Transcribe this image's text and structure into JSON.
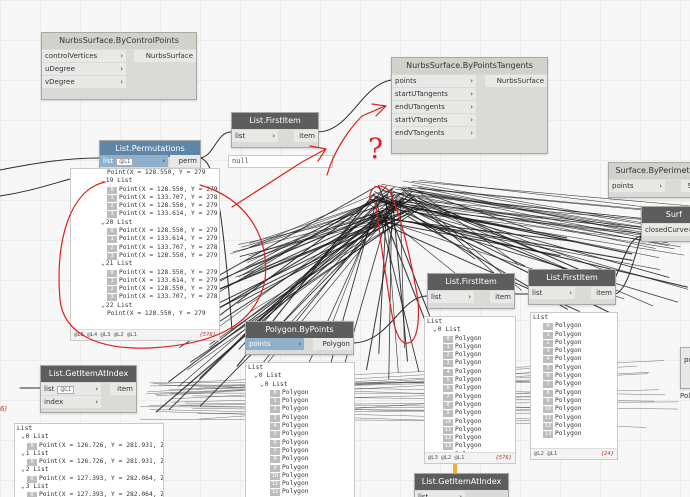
{
  "nodes": {
    "cp": {
      "title": "NurbsSurface.ByControlPoints",
      "inputs": [
        "controlVertices",
        "uDegree",
        "vDegree"
      ],
      "output": "NurbsSurface"
    },
    "pt": {
      "title": "NurbsSurface.ByPointsTangents",
      "inputs": [
        "points",
        "startUTangents",
        "endUTangents",
        "startVTangents",
        "endVTangents"
      ],
      "output": "NurbsSurface"
    },
    "fi1": {
      "title": "List.FirstItem",
      "input": "list",
      "output": "item",
      "preview": "null"
    },
    "perm": {
      "title": "List.Permutations",
      "inputs": [
        "list",
        "length"
      ],
      "output": "perm",
      "preview_rows": [
        {
          "t": "Point(X = 128.550, Y = 279"
        },
        {
          "t": "19 List",
          "h": true
        },
        {
          "i": "0",
          "t": "Point(X = 128.550, Y = 279"
        },
        {
          "i": "1",
          "t": "Point(X = 133.707, Y = 278"
        },
        {
          "i": "2",
          "t": "Point(X = 128.550, Y = 279"
        },
        {
          "i": "3",
          "t": "Point(X = 133.614, Y = 279"
        },
        {
          "t": "20 List",
          "h": true
        },
        {
          "i": "0",
          "t": "Point(X = 128.550, Y = 279"
        },
        {
          "i": "1",
          "t": "Point(X = 133.614, Y = 279"
        },
        {
          "i": "2",
          "t": "Point(X = 133.707, Y = 278"
        },
        {
          "i": "3",
          "t": "Point(X = 128.550, Y = 279"
        },
        {
          "t": "21 List",
          "h": true
        },
        {
          "i": "0",
          "t": "Point(X = 128.550, Y = 279"
        },
        {
          "i": "1",
          "t": "Point(X = 133.614, Y = 279"
        },
        {
          "i": "2",
          "t": "Point(X = 128.550, Y = 279"
        },
        {
          "i": "3",
          "t": "Point(X = 133.707, Y = 278"
        },
        {
          "t": "22 List",
          "h": true
        },
        {
          "t": "Point(X = 128.550, Y = 279"
        }
      ],
      "footer_levels": "@L5 @L4 @L3 @L2 @L1",
      "count": "{576}"
    },
    "surf_per": {
      "title": "Surface.ByPerimeterP",
      "input": "points",
      "output": "S"
    },
    "surf2": {
      "title": "Surf",
      "input": "closedCurve"
    },
    "fi2": {
      "title": "List.FirstItem",
      "input": "list",
      "output": "item",
      "preview_head": [
        "List",
        "0 List"
      ],
      "items": [
        "Polygon",
        "Polygon",
        "Polygon",
        "Polygon",
        "Polygon",
        "Polygon",
        "Polygon",
        "Polygon",
        "Polygon",
        "Polygon",
        "Polygon",
        "Polygon",
        "Polygon",
        "Polygon",
        "Polygon"
      ],
      "footer_levels": "@L3 @L2 @L1",
      "count": "{576}"
    },
    "fi3": {
      "title": "List.FirstItem",
      "input": "list",
      "output": "item",
      "preview_head": [
        "List"
      ],
      "items": [
        "Polygon",
        "Polygon",
        "Polygon",
        "Polygon",
        "Polygon",
        "Polygon",
        "Polygon",
        "Polygon",
        "Polygon",
        "Polygon",
        "Polygon",
        "Polygon",
        "Polygon",
        "Polygon"
      ],
      "footer_levels": "@L2 @L1",
      "count": "{24}"
    },
    "poly": {
      "title": "Polygon.ByPoints",
      "input": "points",
      "output": "Polygon",
      "preview_head": [
        "List",
        "0 List",
        "0 List"
      ],
      "items": [
        "Polygon",
        "Polygon",
        "Polygon",
        "Polygon",
        "Polygon",
        "Polygon",
        "Polygon",
        "Polygon",
        "Polygon",
        "Polygon",
        "Polygon",
        "Polygon",
        "Polygon",
        "Polygon"
      ]
    },
    "gia": {
      "title": "List.GetItemAtIndex",
      "inputs": [
        "list",
        "index"
      ],
      "output": "item",
      "list_tag": "@L1",
      "preview_rows": [
        {
          "t": "List"
        },
        {
          "t": "0 List",
          "h": true
        },
        {
          "i": "0",
          "t": "Point(X = 126.726, Y = 281.931, Z"
        },
        {
          "t": "1 List",
          "h": true
        },
        {
          "i": "0",
          "t": "Point(X = 126.726, Y = 281.931, Z"
        },
        {
          "t": "2 List",
          "h": true
        },
        {
          "i": "0",
          "t": "Point(X = 127.393, Y = 282.064, Z"
        },
        {
          "t": "3 List",
          "h": true
        },
        {
          "i": "0",
          "t": "Point(X = 127.393, Y = 282.064, Z"
        }
      ]
    },
    "gia2": {
      "title": "List.GetItemAtIndex",
      "input": "list"
    },
    "edge_left_count": "6)",
    "edge_right_out": "po",
    "edge_right_pol": "Pol"
  },
  "annotation": {
    "question": "?",
    "color": "#e0201b"
  },
  "wire_color": "#1a1a1a",
  "accent_blue": "#5f86a7"
}
